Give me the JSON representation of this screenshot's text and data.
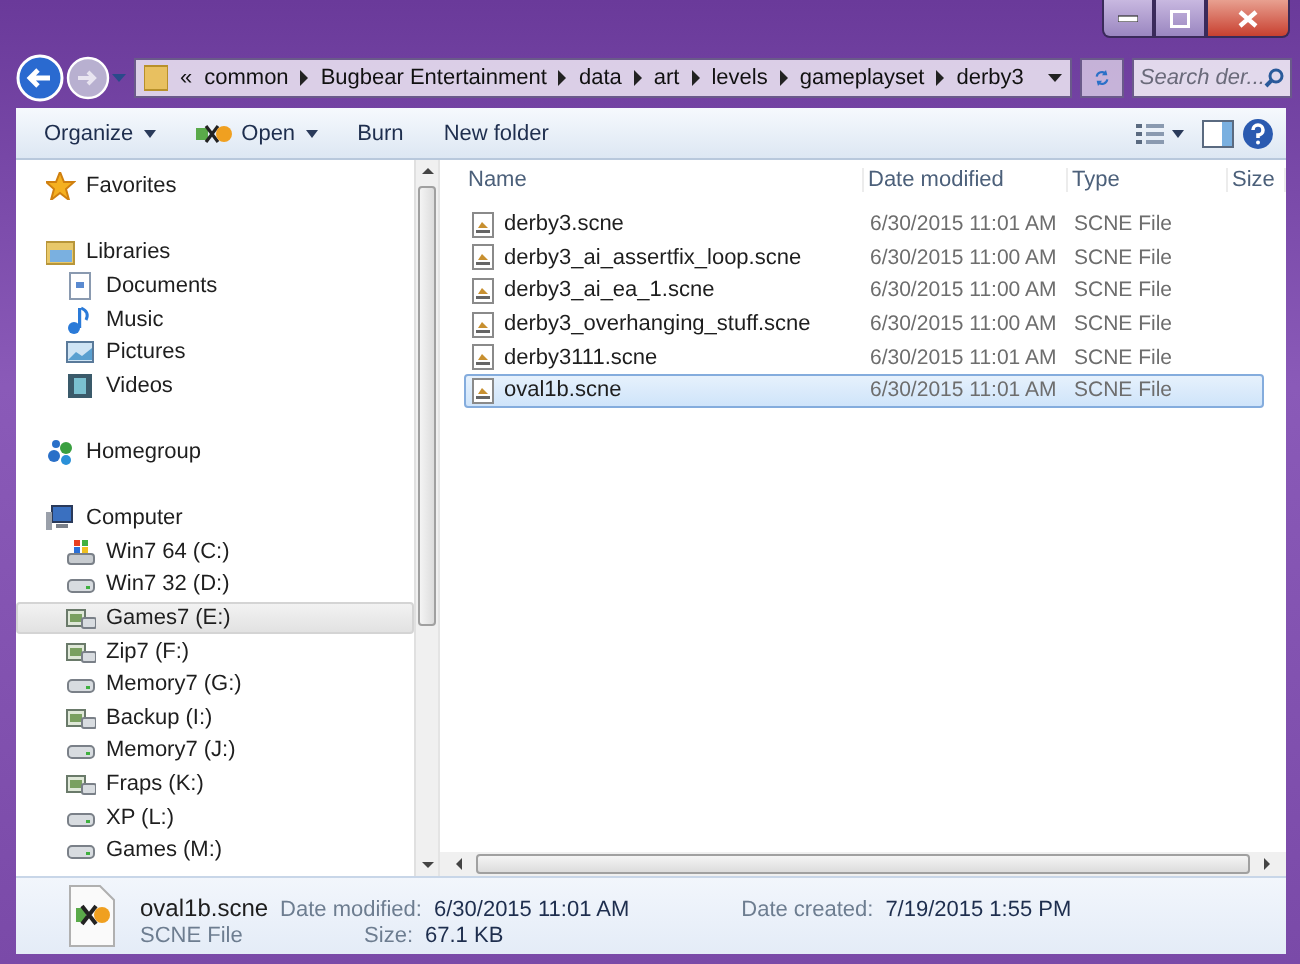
{
  "address_bar": {
    "overflow_marker": "«",
    "path": [
      "common",
      "Bugbear Entertainment",
      "data",
      "art",
      "levels",
      "gameplayset",
      "derby3"
    ],
    "search_placeholder": "Search der..."
  },
  "toolbar": {
    "items": [
      {
        "label": "Organize",
        "kind": "menu"
      },
      {
        "label": "Open",
        "kind": "app-menu"
      },
      {
        "label": "Burn",
        "kind": "plain"
      },
      {
        "label": "New folder",
        "kind": "plain"
      }
    ]
  },
  "navigation": [
    {
      "label": "Favorites",
      "kind": "favorites",
      "selected": false
    },
    {
      "label": "Libraries",
      "kind": "libraries",
      "selected": false,
      "children": [
        {
          "label": "Documents",
          "kind": "documents",
          "selected": false
        },
        {
          "label": "Music",
          "kind": "music",
          "selected": false
        },
        {
          "label": "Pictures",
          "kind": "pictures",
          "selected": false
        },
        {
          "label": "Videos",
          "kind": "videos",
          "selected": false
        }
      ]
    },
    {
      "label": "Homegroup",
      "kind": "homegroup",
      "selected": false
    },
    {
      "label": "Computer",
      "kind": "computer",
      "selected": false,
      "children": [
        {
          "label": "Win7 64 (C:)",
          "kind": "system-drive",
          "selected": false
        },
        {
          "label": "Win7 32 (D:)",
          "kind": "drive",
          "selected": false
        },
        {
          "label": "Games7 (E:)",
          "kind": "network-drive",
          "selected": true
        },
        {
          "label": "Zip7 (F:)",
          "kind": "network-drive",
          "selected": false
        },
        {
          "label": "Memory7 (G:)",
          "kind": "drive",
          "selected": false
        },
        {
          "label": "Backup (I:)",
          "kind": "network-drive",
          "selected": false
        },
        {
          "label": "Memory7 (J:)",
          "kind": "drive",
          "selected": false
        },
        {
          "label": "Fraps (K:)",
          "kind": "network-drive",
          "selected": false
        },
        {
          "label": "XP (L:)",
          "kind": "drive",
          "selected": false
        },
        {
          "label": "Games (M:)",
          "kind": "drive",
          "selected": false
        }
      ]
    }
  ],
  "columns": [
    "Name",
    "Date modified",
    "Type",
    "Size"
  ],
  "files": [
    {
      "name": "derby3.scne",
      "date_modified": "6/30/2015 11:01 AM",
      "type": "SCNE File",
      "selected": false
    },
    {
      "name": "derby3_ai_assertfix_loop.scne",
      "date_modified": "6/30/2015 11:00 AM",
      "type": "SCNE File",
      "selected": false
    },
    {
      "name": "derby3_ai_ea_1.scne",
      "date_modified": "6/30/2015 11:00 AM",
      "type": "SCNE File",
      "selected": false
    },
    {
      "name": "derby3_overhanging_stuff.scne",
      "date_modified": "6/30/2015 11:00 AM",
      "type": "SCNE File",
      "selected": false
    },
    {
      "name": "derby3111.scne",
      "date_modified": "6/30/2015 11:01 AM",
      "type": "SCNE File",
      "selected": false
    },
    {
      "name": "oval1b.scne",
      "date_modified": "6/30/2015 11:01 AM",
      "type": "SCNE File",
      "selected": true
    }
  ],
  "details": {
    "name": "oval1b.scne",
    "type": "SCNE File",
    "fields": [
      {
        "label": "Date modified:",
        "value": "6/30/2015 11:01 AM"
      },
      {
        "label": "Size:",
        "value": "67.1 KB"
      },
      {
        "label": "Date created:",
        "value": "7/19/2015 1:55 PM"
      }
    ]
  }
}
